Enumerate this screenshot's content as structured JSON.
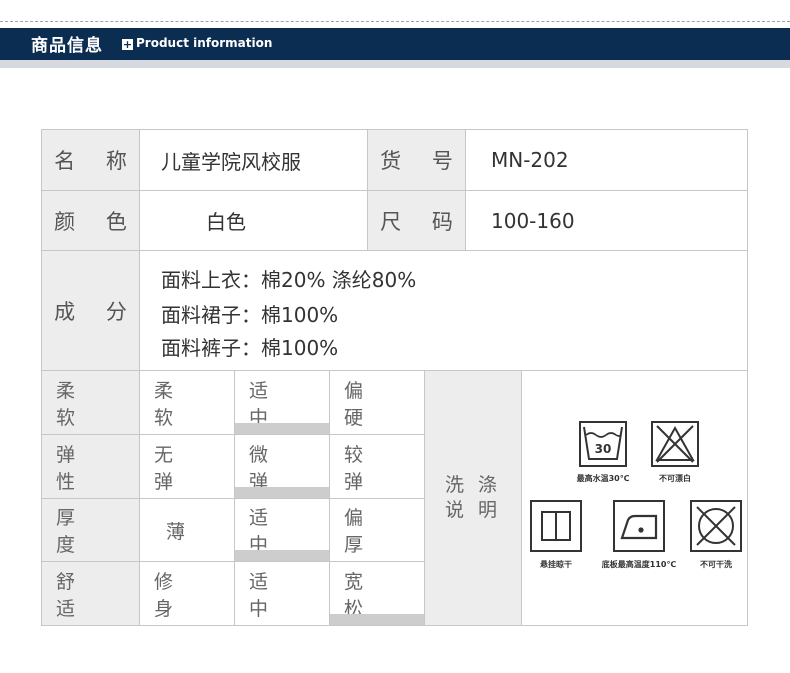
{
  "header": {
    "title": "商品信息",
    "subtitle": "Product information"
  },
  "info": {
    "name_label": "名 称",
    "name_value": "儿童学院风校服",
    "sku_label": "货 号",
    "sku_value": "MN-202",
    "color_label": "颜 色",
    "color_value": "白色",
    "size_label": "尺 码",
    "size_value": "100-160",
    "composition_label": "成 分",
    "composition": [
      "面料上衣：棉20% 涤纶80%",
      "面料裙子：棉100%",
      "面料裤子：棉100%"
    ]
  },
  "ratings": [
    {
      "label": "柔 软",
      "options": [
        "柔 软",
        "适 中",
        "偏 硬"
      ],
      "selected_index": 1
    },
    {
      "label": "弹 性",
      "options": [
        "无 弹",
        "微 弹",
        "较 弹"
      ],
      "selected_index": 1
    },
    {
      "label": "厚 度",
      "options": [
        "薄",
        "适 中",
        "偏 厚"
      ],
      "selected_index": 1
    },
    {
      "label": "舒 适",
      "options": [
        "修 身",
        "适 中",
        "宽 松"
      ],
      "selected_index": 2
    }
  ],
  "washing": {
    "label_line1": "洗 涤",
    "label_line2": "说 明",
    "icons": [
      {
        "icon": "wash-30-icon",
        "temp": "30",
        "caption": "最高水温30℃"
      },
      {
        "icon": "no-bleach-icon",
        "caption": "不可漂白"
      },
      {
        "icon": "hang-dry-icon",
        "caption": "悬挂晾干"
      },
      {
        "icon": "iron-110-icon",
        "caption": "底板最高温度110℃"
      },
      {
        "icon": "no-dry-clean-icon",
        "caption": "不可干洗"
      }
    ]
  },
  "colors": {
    "header_bg": "#0b2d52",
    "label_bg": "#ededed",
    "selected_bar": "#cdcdcd",
    "border": "#c7c7c7"
  }
}
